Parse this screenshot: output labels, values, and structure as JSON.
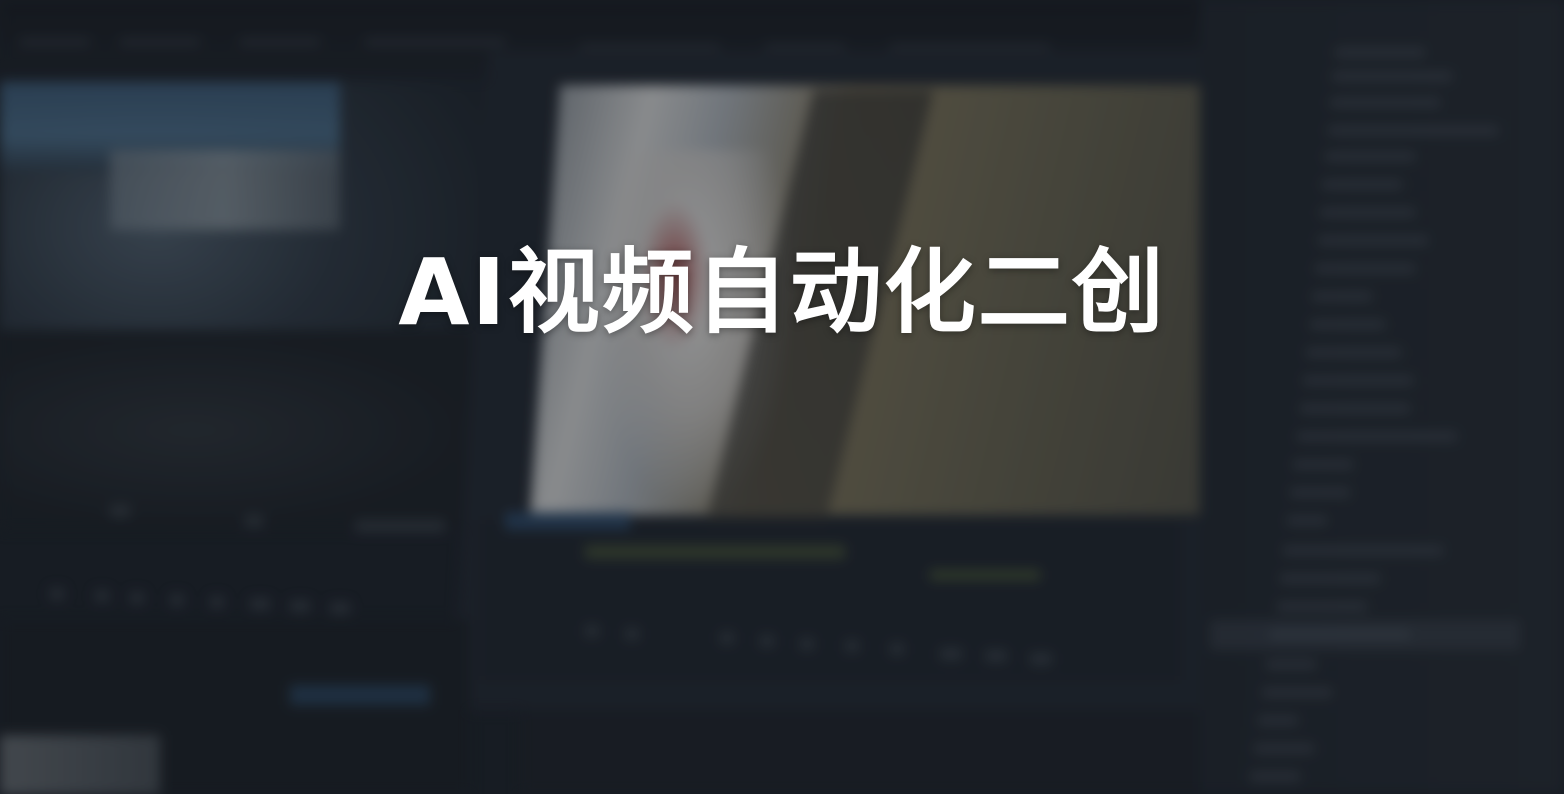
{
  "banner": {
    "title": "AI视频自动化二创"
  },
  "background": {
    "description_icon": "video-editor-screenshot-icon",
    "colors": {
      "base": "#1b1f27",
      "panel": "#20252e",
      "accent_blue": "#2c4a6b",
      "accent_green": "#55623a",
      "title_text": "#ffffff"
    }
  }
}
